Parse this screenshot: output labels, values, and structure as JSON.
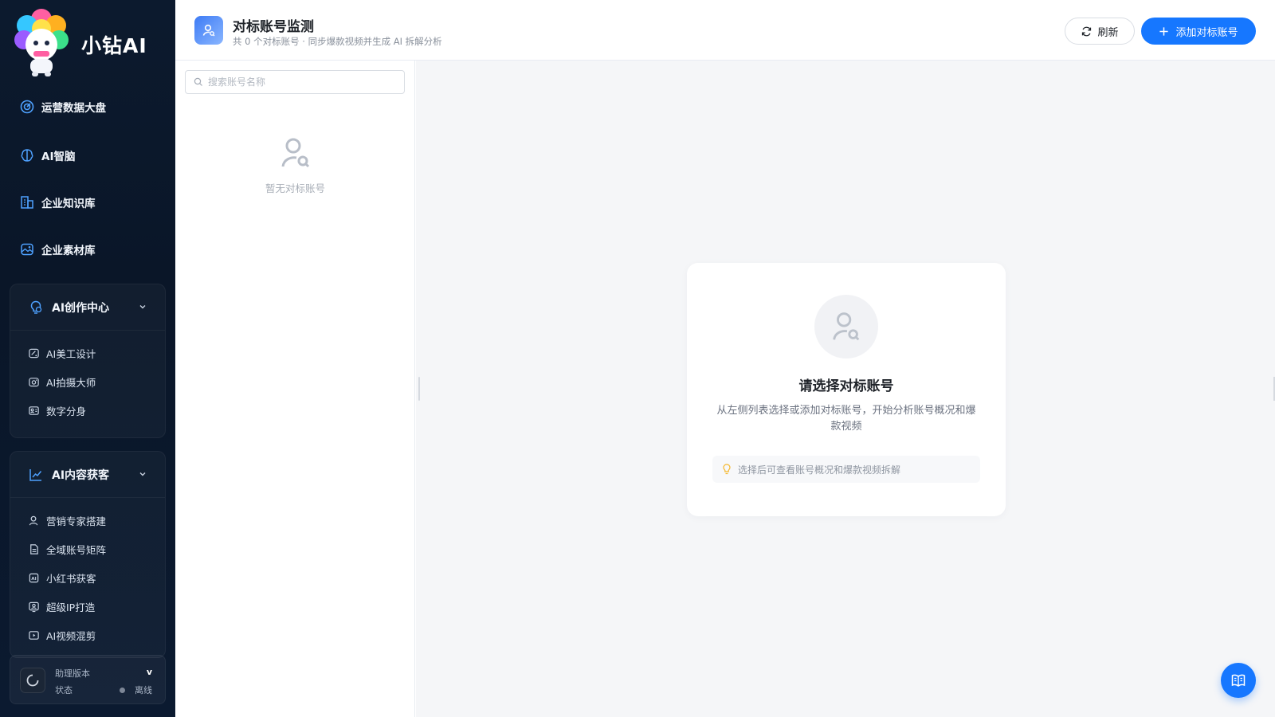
{
  "brand": {
    "name": "小钻AI",
    "logo_text": "小钻AI"
  },
  "sidebar": {
    "items": [
      {
        "label": "运营数据大盘",
        "icon": "dashboard-icon"
      },
      {
        "label": "AI智脑",
        "icon": "brain-icon"
      },
      {
        "label": "企业知识库",
        "icon": "building-icon"
      },
      {
        "label": "企业素材库",
        "icon": "image-icon"
      }
    ],
    "groups": [
      {
        "label": "AI创作中心",
        "icon": "lightbulb-icon",
        "items": [
          {
            "label": "AI美工设计",
            "icon": "design-icon"
          },
          {
            "label": "AI拍摄大师",
            "icon": "camera-icon"
          },
          {
            "label": "数字分身",
            "icon": "avatar-card-icon"
          }
        ]
      },
      {
        "label": "AI内容获客",
        "icon": "chart-line-icon",
        "items": [
          {
            "label": "营销专家搭建",
            "icon": "user-icon"
          },
          {
            "label": "全域账号矩阵",
            "icon": "document-icon"
          },
          {
            "label": "小红书获客",
            "icon": "ai-badge-icon"
          },
          {
            "label": "超级IP打造",
            "icon": "ip-icon"
          },
          {
            "label": "AI视频混剪",
            "icon": "video-icon"
          }
        ]
      }
    ],
    "status": {
      "version_label": "助理版本",
      "version_value": "v",
      "state_label": "状态",
      "state_value": "离线"
    }
  },
  "header": {
    "title": "对标账号监测",
    "subtitle": "共 0 个对标账号 · 同步爆款视频并生成 AI 拆解分析",
    "refresh_label": "刷新",
    "add_label": "添加对标账号"
  },
  "left_panel": {
    "search_placeholder": "搜索账号名称",
    "empty_text": "暂无对标账号"
  },
  "empty_state": {
    "title": "请选择对标账号",
    "description": "从左侧列表选择或添加对标账号，开始分析账号概况和爆款视频",
    "tip": "选择后可查看账号概况和爆款视频拆解"
  },
  "colors": {
    "accent": "#1677ff",
    "sidebar_bg": "#0c1a2e",
    "tip_icon": "#f5b82e"
  }
}
